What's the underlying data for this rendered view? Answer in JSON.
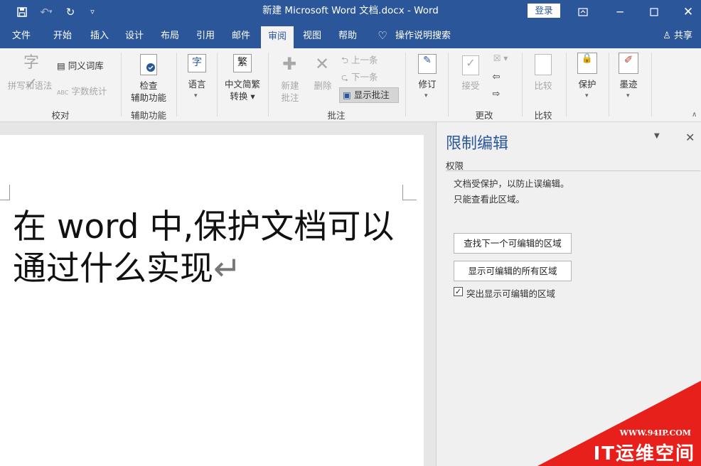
{
  "window": {
    "title": "新建 Microsoft Word 文档.docx  -  Word",
    "login": "登录"
  },
  "tabs": [
    {
      "label": "文件"
    },
    {
      "label": "开始"
    },
    {
      "label": "插入"
    },
    {
      "label": "设计"
    },
    {
      "label": "布局"
    },
    {
      "label": "引用"
    },
    {
      "label": "邮件"
    },
    {
      "label": "审阅"
    },
    {
      "label": "视图"
    },
    {
      "label": "帮助"
    },
    {
      "label": "操作说明搜索"
    }
  ],
  "share": "共享",
  "ribbon": {
    "spelling": "拼写和语法",
    "thesaurus": "同义词库",
    "wordcount": "字数统计",
    "group_proofing": "校对",
    "check_a11y_1": "检查",
    "check_a11y_2": "辅助功能",
    "group_a11y": "辅助功能",
    "language": "语言",
    "chinese_conv_1": "中文简繁",
    "chinese_conv_2": "转换",
    "new_comment_1": "新建",
    "new_comment_2": "批注",
    "delete_comment": "删除",
    "prev_comment": "上一条",
    "next_comment": "下一条",
    "show_comments": "显示批注",
    "group_comments": "批注",
    "track": "修订",
    "accept": "接受",
    "group_changes": "更改",
    "compare": "比较",
    "group_compare": "比较",
    "protect": "保护",
    "ink": "墨迹"
  },
  "document": {
    "text": "在 word 中,保护文档可以通过什么实现",
    "para_mark": "↵"
  },
  "panel": {
    "title": "限制编辑",
    "section": "权限",
    "msg1": "文档受保护，以防止误编辑。",
    "msg2": "只能查看此区域。",
    "btn_next": "查找下一个可编辑的区域",
    "btn_all": "显示可编辑的所有区域",
    "chk_label": "突出显示可编辑的区域",
    "chk_checked": true
  },
  "watermark": {
    "url": "WWW.94IP.COM",
    "name": "IT运维空间"
  },
  "colors": {
    "accent": "#2b579a",
    "watermark": "#e8201c"
  }
}
